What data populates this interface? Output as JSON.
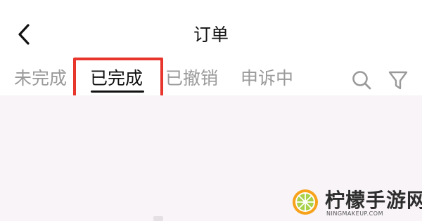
{
  "header": {
    "title": "订单",
    "back_icon": "chevron-left-icon"
  },
  "tabs": [
    {
      "label": "未完成",
      "active": false
    },
    {
      "label": "已完成",
      "active": true
    },
    {
      "label": "已撤销",
      "active": false
    },
    {
      "label": "申诉中",
      "active": false
    }
  ],
  "actions": {
    "search_icon": "search-icon",
    "filter_icon": "filter-icon"
  },
  "highlight_color": "#e8362d",
  "watermark": {
    "title": "柠檬手游网",
    "subtitle": "NINGMAKEUP.COM"
  }
}
